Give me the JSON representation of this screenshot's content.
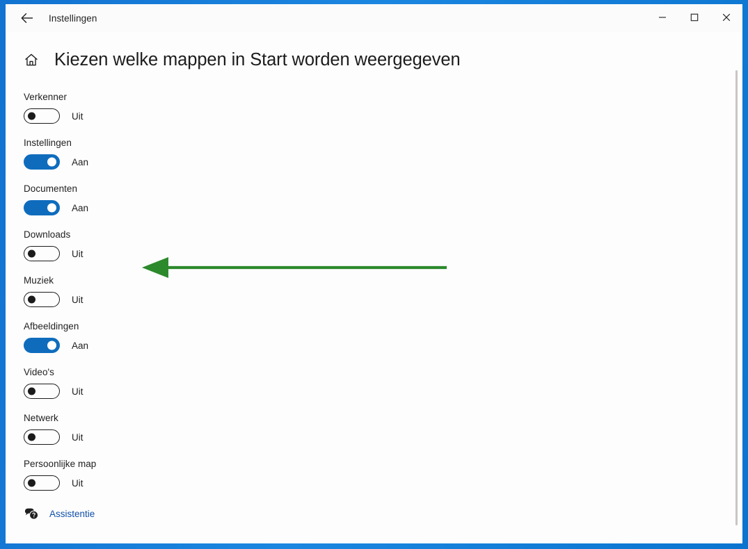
{
  "window": {
    "titlebar_title": "Instellingen",
    "back_icon": "arrow-left-icon",
    "minimize_label": "—",
    "maximize_label": "☐",
    "close_label": "✕",
    "frame_color": "#1279d4"
  },
  "page": {
    "home_icon": "home-icon",
    "title": "Kiezen welke mappen in Start worden weergegeven"
  },
  "settings": {
    "items": [
      {
        "label": "Verkenner",
        "state": "Uit",
        "on": false
      },
      {
        "label": "Instellingen",
        "state": "Aan",
        "on": true
      },
      {
        "label": "Documenten",
        "state": "Aan",
        "on": true
      },
      {
        "label": "Downloads",
        "state": "Uit",
        "on": false
      },
      {
        "label": "Muziek",
        "state": "Uit",
        "on": false
      },
      {
        "label": "Afbeeldingen",
        "state": "Aan",
        "on": true
      },
      {
        "label": "Video's",
        "state": "Uit",
        "on": false
      },
      {
        "label": "Netwerk",
        "state": "Uit",
        "on": false
      },
      {
        "label": "Persoonlijke map",
        "state": "Uit",
        "on": false
      }
    ],
    "on_color": "#0f6cbd",
    "off_color": "#1b1b1b"
  },
  "help": {
    "icon": "help-bubbles-icon",
    "label": "Assistentie",
    "link_color": "#0f4fa8"
  },
  "annotation": {
    "type": "arrow-left",
    "color": "#2c8a2c"
  }
}
